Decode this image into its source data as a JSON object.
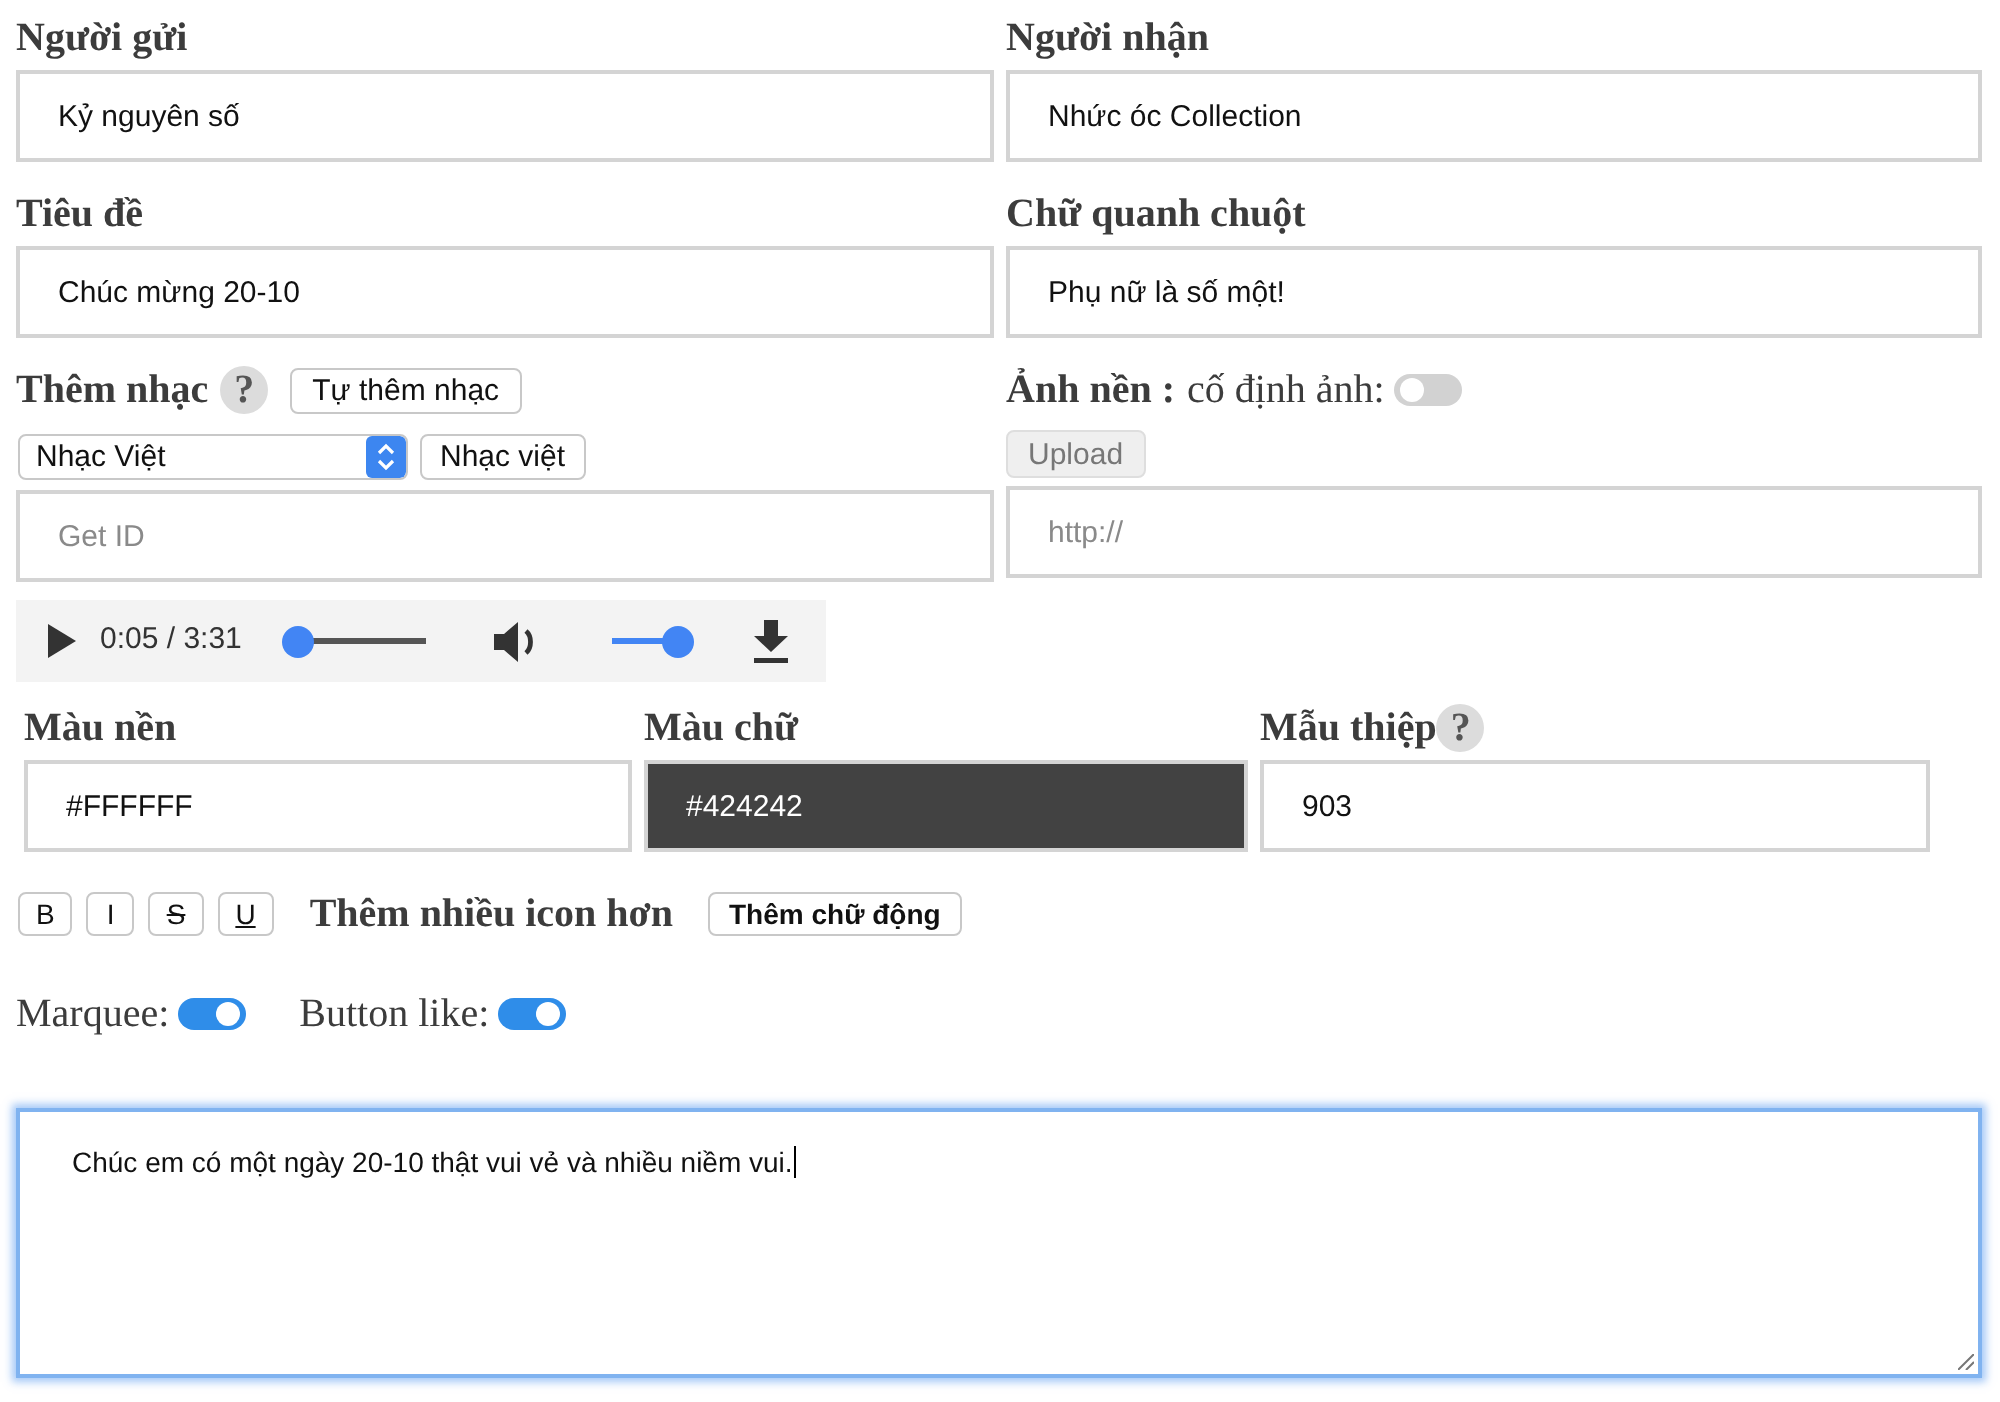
{
  "sender": {
    "label": "Người gửi",
    "value": "Kỷ nguyên số"
  },
  "recipient": {
    "label": "Người nhận",
    "value": "Nhức óc Collection"
  },
  "title": {
    "label": "Tiêu đề",
    "value": "Chúc mừng 20-10"
  },
  "cursor_text": {
    "label": "Chữ quanh chuột",
    "value": "Phụ nữ là số một!"
  },
  "music": {
    "label": "Thêm nhạc",
    "help": "?",
    "add_button": "Tự thêm nhạc",
    "genre_select": {
      "value": "Nhạc Việt"
    },
    "genre_button": "Nhạc việt",
    "id_field": {
      "placeholder": "Get ID"
    }
  },
  "background_image": {
    "label": "Ảnh nền :",
    "fixed_label": "cố định ảnh:",
    "fixed": false,
    "upload_button": "Upload",
    "url_field": {
      "placeholder": "http://"
    }
  },
  "player": {
    "time": "0:05 / 3:31",
    "progress": {
      "level": 0.02
    },
    "volume": {
      "level": 1
    }
  },
  "colors": [
    {
      "label": "Màu nền",
      "value": "#FFFFFF"
    },
    {
      "label": "Màu chữ",
      "value": "#424242"
    }
  ],
  "template": {
    "label": "Mẫu thiệp",
    "help": "?",
    "value": "903"
  },
  "format_buttons": [
    {
      "kind": "bold",
      "label": "B"
    },
    {
      "kind": "italic",
      "label": "I"
    },
    {
      "kind": "strike",
      "label": "S"
    },
    {
      "kind": "underline",
      "label": "U"
    }
  ],
  "more_icons_label": "Thêm nhiều icon hơn",
  "animated_text_button": "Thêm chữ động",
  "switches": [
    {
      "label": "Marquee:",
      "on": true
    },
    {
      "label": "Button like:",
      "on": true
    }
  ],
  "message": {
    "value": "Chúc em có một ngày 20-10 thật vui vẻ và nhiều niềm vui.",
    "focused": true
  }
}
